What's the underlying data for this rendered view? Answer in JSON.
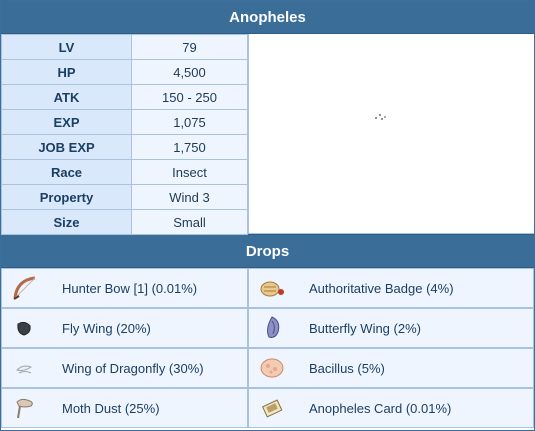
{
  "monster": {
    "name": "Anopheles"
  },
  "stats": [
    {
      "label": "LV",
      "value": "79"
    },
    {
      "label": "HP",
      "value": "4,500"
    },
    {
      "label": "ATK",
      "value": "150 - 250"
    },
    {
      "label": "EXP",
      "value": "1,075"
    },
    {
      "label": "JOB EXP",
      "value": "1,750"
    },
    {
      "label": "Race",
      "value": "Insect"
    },
    {
      "label": "Property",
      "value": "Wind 3"
    },
    {
      "label": "Size",
      "value": "Small"
    }
  ],
  "drops_header": "Drops",
  "drops": [
    {
      "label": "Hunter Bow [1] (0.01%)",
      "icon": "bow-icon"
    },
    {
      "label": "Authoritative Badge (4%)",
      "icon": "badge-icon"
    },
    {
      "label": "Fly Wing (20%)",
      "icon": "fly-wing-icon"
    },
    {
      "label": "Butterfly Wing (2%)",
      "icon": "butterfly-wing-icon"
    },
    {
      "label": "Wing of Dragonfly (30%)",
      "icon": "dragonfly-wing-icon"
    },
    {
      "label": "Bacillus (5%)",
      "icon": "bacillus-icon"
    },
    {
      "label": "Moth Dust (25%)",
      "icon": "moth-dust-icon"
    },
    {
      "label": "Anopheles Card (0.01%)",
      "icon": "card-icon"
    }
  ],
  "colors": {
    "header": "#3b6d99",
    "key_cell": "#d9e9fb",
    "value_cell": "#eef5fe",
    "border": "#a9c3dc"
  }
}
